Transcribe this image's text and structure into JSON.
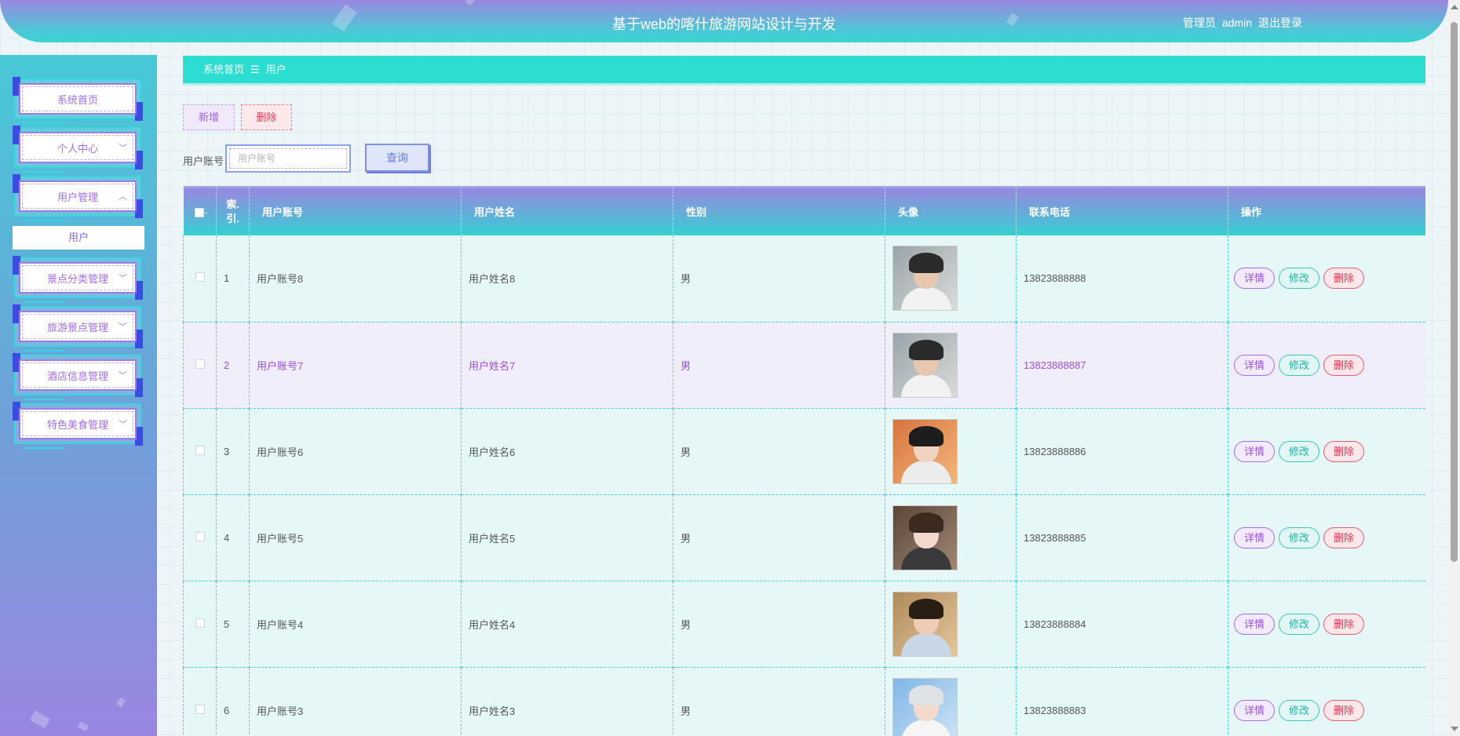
{
  "header": {
    "title": "基于web的喀什旅游网站设计与开发",
    "role": "管理员",
    "username": "admin",
    "logout_label": "退出登录"
  },
  "sidebar": {
    "items": [
      {
        "label": "系统首页",
        "chevron": ""
      },
      {
        "label": "个人中心",
        "chevron": "﹀"
      },
      {
        "label": "用户管理",
        "chevron": "︿"
      },
      {
        "label": "景点分类管理",
        "chevron": "﹀"
      },
      {
        "label": "旅游景点管理",
        "chevron": "﹀"
      },
      {
        "label": "酒店信息管理",
        "chevron": "﹀"
      },
      {
        "label": "特色美食管理",
        "chevron": "﹀"
      }
    ],
    "submenu_label": "用户"
  },
  "breadcrumb": {
    "home": "系统首页",
    "separator": "☰",
    "current": "用户"
  },
  "toolbar": {
    "add_label": "新增",
    "delete_label": "删除"
  },
  "search": {
    "label": "用户账号",
    "placeholder": "用户账号",
    "value": "",
    "query_label": "查询"
  },
  "table": {
    "columns": [
      "索引",
      "用户账号",
      "用户姓名",
      "性别",
      "头像",
      "联系电话",
      "操作"
    ],
    "index_header_line1": "索.",
    "index_header_line2": "引.",
    "rows": [
      {
        "index": "1",
        "account": "用户账号8",
        "name": "用户姓名8",
        "gender": "男",
        "phone": "13823888888"
      },
      {
        "index": "2",
        "account": "用户账号7",
        "name": "用户姓名7",
        "gender": "男",
        "phone": "13823888887"
      },
      {
        "index": "3",
        "account": "用户账号6",
        "name": "用户姓名6",
        "gender": "男",
        "phone": "13823888886"
      },
      {
        "index": "4",
        "account": "用户账号5",
        "name": "用户姓名5",
        "gender": "男",
        "phone": "13823888885"
      },
      {
        "index": "5",
        "account": "用户账号4",
        "name": "用户姓名4",
        "gender": "男",
        "phone": "13823888884"
      },
      {
        "index": "6",
        "account": "用户账号3",
        "name": "用户姓名3",
        "gender": "男",
        "phone": "13823888883"
      }
    ],
    "actions": {
      "detail": "详情",
      "edit": "修改",
      "delete": "删除"
    }
  },
  "colors": {
    "accent_teal": "#2cddd2",
    "accent_purple": "#9a86e0",
    "delete_red": "#d63b52"
  }
}
